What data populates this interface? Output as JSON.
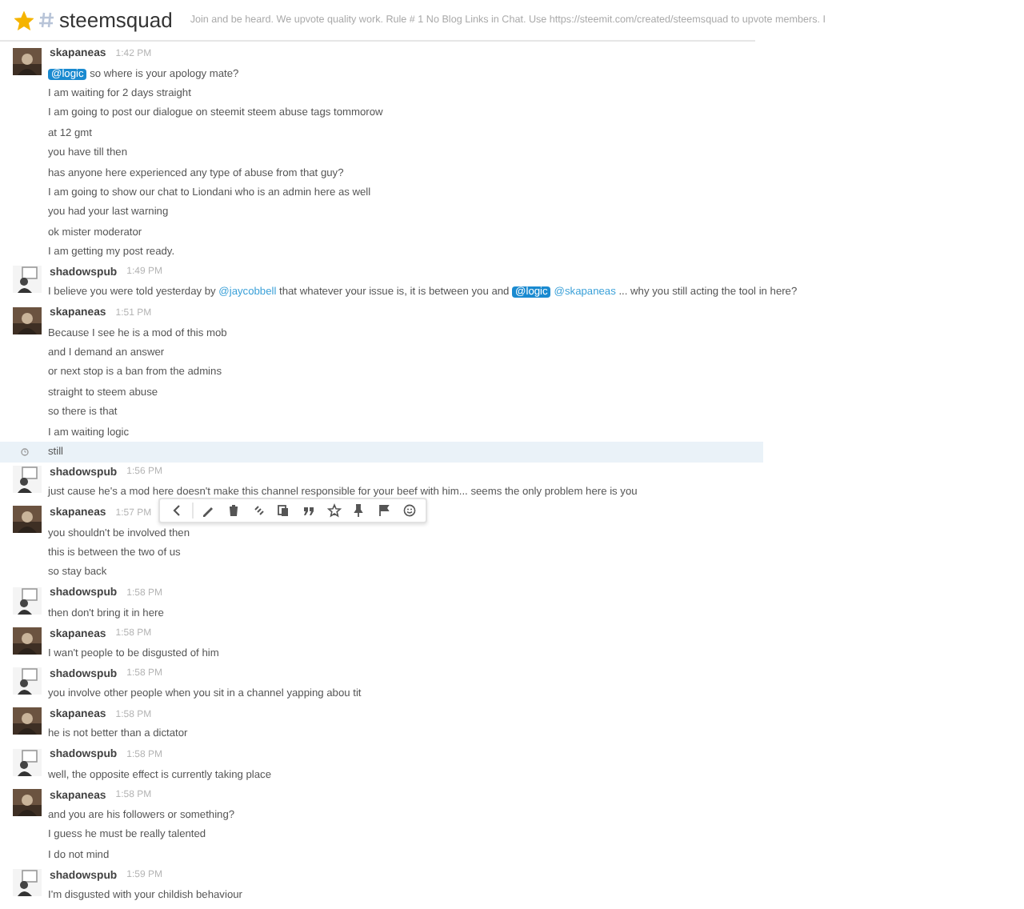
{
  "channel": {
    "starred": true,
    "name": "steemsquad",
    "topic": "Join and be heard. We upvote quality work. Rule # 1 No Blog Links in Chat. Use https://steemit.com/created/steemsquad to upvote members. I"
  },
  "messages": [
    {
      "author": "skapaneas",
      "time": "1:42 PM",
      "kind": "dark",
      "lines": [
        {
          "hovered": false,
          "segments": [
            {
              "kind": "badge",
              "text": "@logic"
            },
            {
              "kind": "text",
              "text": " so where is your apology mate?"
            }
          ]
        },
        {
          "hovered": false,
          "segments": [
            {
              "kind": "text",
              "text": "I am waiting for 2 days straight"
            }
          ]
        },
        {
          "hovered": false,
          "segments": [
            {
              "kind": "text",
              "text": "I am going to post our dialogue on steemit steem abuse tags tommorow"
            }
          ]
        },
        {
          "hovered": false,
          "segments": [
            {
              "kind": "text",
              "text": "at 12 gmt"
            }
          ]
        },
        {
          "hovered": false,
          "segments": [
            {
              "kind": "text",
              "text": "you have till then"
            }
          ]
        },
        {
          "hovered": false,
          "segments": [
            {
              "kind": "text",
              "text": "has anyone here experienced any type of abuse from that guy?"
            }
          ]
        },
        {
          "hovered": false,
          "segments": [
            {
              "kind": "text",
              "text": "I am going to show our chat to Liondani who is an admin here as well"
            }
          ]
        },
        {
          "hovered": false,
          "segments": [
            {
              "kind": "text",
              "text": "you had your last warning"
            }
          ]
        },
        {
          "hovered": false,
          "segments": [
            {
              "kind": "text",
              "text": "ok mister moderator"
            }
          ]
        },
        {
          "hovered": false,
          "segments": [
            {
              "kind": "text",
              "text": "I am getting my post ready."
            }
          ]
        }
      ]
    },
    {
      "author": "shadowspub",
      "time": "1:49 PM",
      "kind": "light",
      "lines": [
        {
          "hovered": false,
          "segments": [
            {
              "kind": "text",
              "text": "I believe you were told yesterday by "
            },
            {
              "kind": "link",
              "text": "@jaycobbell"
            },
            {
              "kind": "text",
              "text": " that whatever your issue is, it is between you and "
            },
            {
              "kind": "badge",
              "text": "@logic"
            },
            {
              "kind": "link",
              "text": "@skapaneas"
            },
            {
              "kind": "text",
              "text": " ... why you still acting the tool in here?"
            }
          ]
        }
      ]
    },
    {
      "author": "skapaneas",
      "time": "1:51 PM",
      "kind": "dark",
      "lines": [
        {
          "hovered": false,
          "segments": [
            {
              "kind": "text",
              "text": "Because I see he is a mod of this mob"
            }
          ]
        },
        {
          "hovered": false,
          "segments": [
            {
              "kind": "text",
              "text": "and I demand an answer"
            }
          ]
        },
        {
          "hovered": false,
          "segments": [
            {
              "kind": "text",
              "text": "or next stop is a ban from the admins"
            }
          ]
        },
        {
          "hovered": false,
          "segments": [
            {
              "kind": "text",
              "text": "straight to steem abuse"
            }
          ]
        },
        {
          "hovered": false,
          "segments": [
            {
              "kind": "text",
              "text": "so there is that"
            }
          ]
        },
        {
          "hovered": false,
          "segments": [
            {
              "kind": "text",
              "text": "I am waiting logic"
            }
          ]
        },
        {
          "hovered": true,
          "segments": [
            {
              "kind": "text",
              "text": "still"
            }
          ]
        }
      ]
    },
    {
      "author": "shadowspub",
      "time": "1:56 PM",
      "kind": "light",
      "lines": [
        {
          "hovered": false,
          "segments": [
            {
              "kind": "text",
              "text": "just cause he's a mod here doesn't make this channel responsible for your beef with him... seems the only problem here is you"
            }
          ]
        }
      ]
    },
    {
      "author": "skapaneas",
      "time": "1:57 PM",
      "kind": "dark",
      "lines": [
        {
          "hovered": false,
          "segments": [
            {
              "kind": "text",
              "text": "you shouldn't be involved then"
            }
          ]
        },
        {
          "hovered": false,
          "segments": [
            {
              "kind": "text",
              "text": "this is between the two of us"
            }
          ]
        },
        {
          "hovered": false,
          "segments": [
            {
              "kind": "text",
              "text": "so stay back"
            }
          ]
        }
      ]
    },
    {
      "author": "shadowspub",
      "time": "1:58 PM",
      "kind": "light",
      "lines": [
        {
          "hovered": false,
          "segments": [
            {
              "kind": "text",
              "text": "then don't bring it in here"
            }
          ]
        }
      ]
    },
    {
      "author": "skapaneas",
      "time": "1:58 PM",
      "kind": "dark",
      "lines": [
        {
          "hovered": false,
          "segments": [
            {
              "kind": "text",
              "text": "I wan't people to be disgusted of him"
            }
          ]
        }
      ]
    },
    {
      "author": "shadowspub",
      "time": "1:58 PM",
      "kind": "light",
      "lines": [
        {
          "hovered": false,
          "segments": [
            {
              "kind": "text",
              "text": "you involve other people when you sit in a channel yapping abou tit"
            }
          ]
        }
      ]
    },
    {
      "author": "skapaneas",
      "time": "1:58 PM",
      "kind": "dark",
      "lines": [
        {
          "hovered": false,
          "segments": [
            {
              "kind": "text",
              "text": "he is not better than a dictator"
            }
          ]
        }
      ]
    },
    {
      "author": "shadowspub",
      "time": "1:58 PM",
      "kind": "light",
      "lines": [
        {
          "hovered": false,
          "segments": [
            {
              "kind": "text",
              "text": "well, the opposite effect is currently taking place"
            }
          ]
        }
      ]
    },
    {
      "author": "skapaneas",
      "time": "1:58 PM",
      "kind": "dark",
      "lines": [
        {
          "hovered": false,
          "segments": [
            {
              "kind": "text",
              "text": "and you are his followers or something?"
            }
          ]
        },
        {
          "hovered": false,
          "segments": [
            {
              "kind": "text",
              "text": "I guess he must be really talented"
            }
          ]
        },
        {
          "hovered": false,
          "segments": [
            {
              "kind": "text",
              "text": "I do not mind"
            }
          ]
        }
      ]
    },
    {
      "author": "shadowspub",
      "time": "1:59 PM",
      "kind": "light",
      "lines": [
        {
          "hovered": false,
          "segments": [
            {
              "kind": "text",
              "text": "I'm disgusted with your childish behaviour"
            }
          ]
        }
      ]
    }
  ],
  "toolbar": {
    "items": [
      {
        "kind": "back"
      },
      {
        "kind": "edit"
      },
      {
        "kind": "delete"
      },
      {
        "kind": "link"
      },
      {
        "kind": "copy"
      },
      {
        "kind": "quote"
      },
      {
        "kind": "star"
      },
      {
        "kind": "pin"
      },
      {
        "kind": "flag"
      },
      {
        "kind": "react"
      }
    ]
  }
}
